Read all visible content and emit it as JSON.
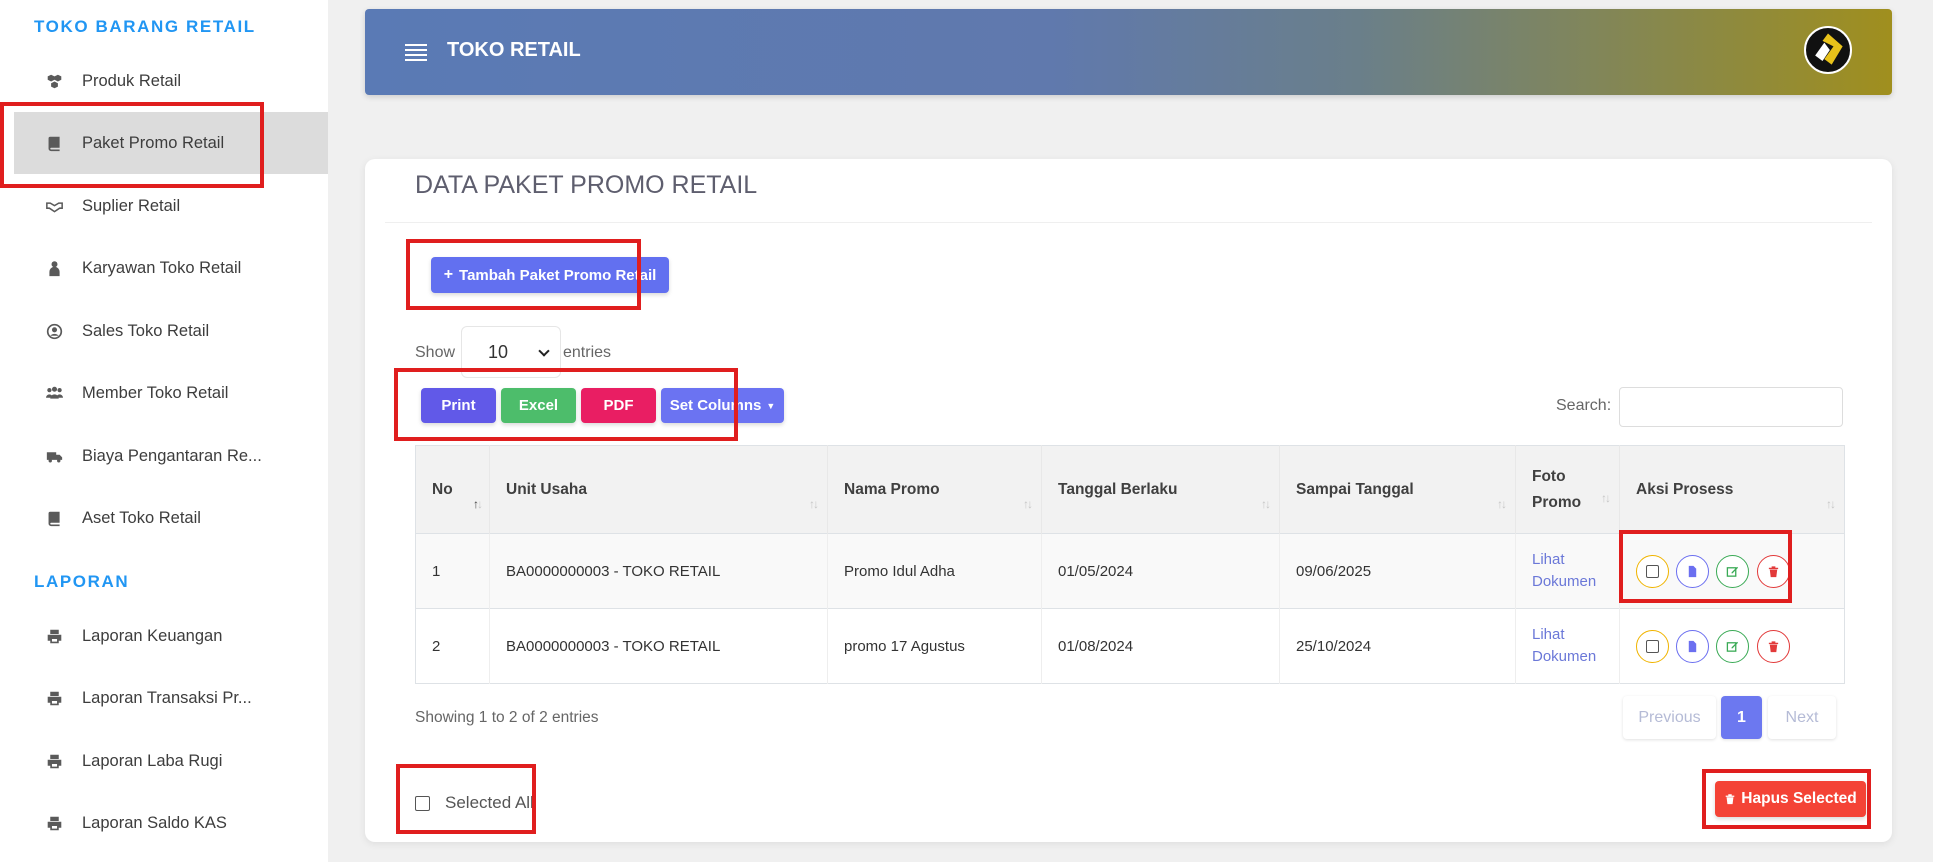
{
  "sidebar": {
    "section_main": "TOKO BARANG RETAIL",
    "section_report": "LAPORAN",
    "items": [
      {
        "label": "Produk Retail",
        "icon": "cubes-icon"
      },
      {
        "label": "Paket Promo Retail",
        "icon": "book-icon",
        "active": true
      },
      {
        "label": "Suplier Retail",
        "icon": "handshake-icon"
      },
      {
        "label": "Karyawan Toko Retail",
        "icon": "user-tie-icon"
      },
      {
        "label": "Sales Toko Retail",
        "icon": "user-circle-icon"
      },
      {
        "label": "Member Toko Retail",
        "icon": "users-icon"
      },
      {
        "label": "Biaya Pengantaran Re...",
        "icon": "truck-icon"
      },
      {
        "label": "Aset Toko Retail",
        "icon": "book-icon"
      }
    ],
    "reports": [
      {
        "label": "Laporan Keuangan",
        "icon": "print-icon"
      },
      {
        "label": "Laporan Transaksi Pr...",
        "icon": "print-icon"
      },
      {
        "label": "Laporan Laba Rugi",
        "icon": "print-icon"
      },
      {
        "label": "Laporan Saldo KAS",
        "icon": "print-icon"
      }
    ]
  },
  "header": {
    "title": "TOKO RETAIL"
  },
  "main": {
    "title": "DATA PAKET PROMO RETAIL",
    "add_button": "Tambah Paket Promo Retail",
    "show_label": "Show",
    "entries_value": "10",
    "entries_label": "entries",
    "export_buttons": {
      "print": "Print",
      "excel": "Excel",
      "pdf": "PDF",
      "columns": "Set Columns"
    },
    "search_label": "Search:",
    "search_value": "",
    "table": {
      "headers": [
        "No",
        "Unit Usaha",
        "Nama Promo",
        "Tanggal Berlaku",
        "Sampai Tanggal",
        "Foto Promo",
        "Aksi Prosess"
      ],
      "rows": [
        {
          "no": "1",
          "unit": "BA0000000003 - TOKO RETAIL",
          "promo": "Promo Idul Adha",
          "start": "01/05/2024",
          "end": "09/06/2025",
          "foto_line1": "Lihat",
          "foto_line2": "Dokumen"
        },
        {
          "no": "2",
          "unit": "BA0000000003 - TOKO RETAIL",
          "promo": "promo 17 Agustus",
          "start": "01/08/2024",
          "end": "25/10/2024",
          "foto_line1": "Lihat",
          "foto_line2": "Dokumen"
        }
      ]
    },
    "showing": "Showing 1 to 2 of 2 entries",
    "pagination": {
      "previous": "Previous",
      "current": "1",
      "next": "Next"
    },
    "selected_all": "Selected All",
    "delete_selected": "Hapus Selected"
  },
  "colors": {
    "accent": "#2196f3",
    "primary_button": "#6270f0",
    "excel": "#4dbd6b",
    "pdf": "#e91e63",
    "danger": "#f44336",
    "highlight_box": "#e01e1e"
  }
}
